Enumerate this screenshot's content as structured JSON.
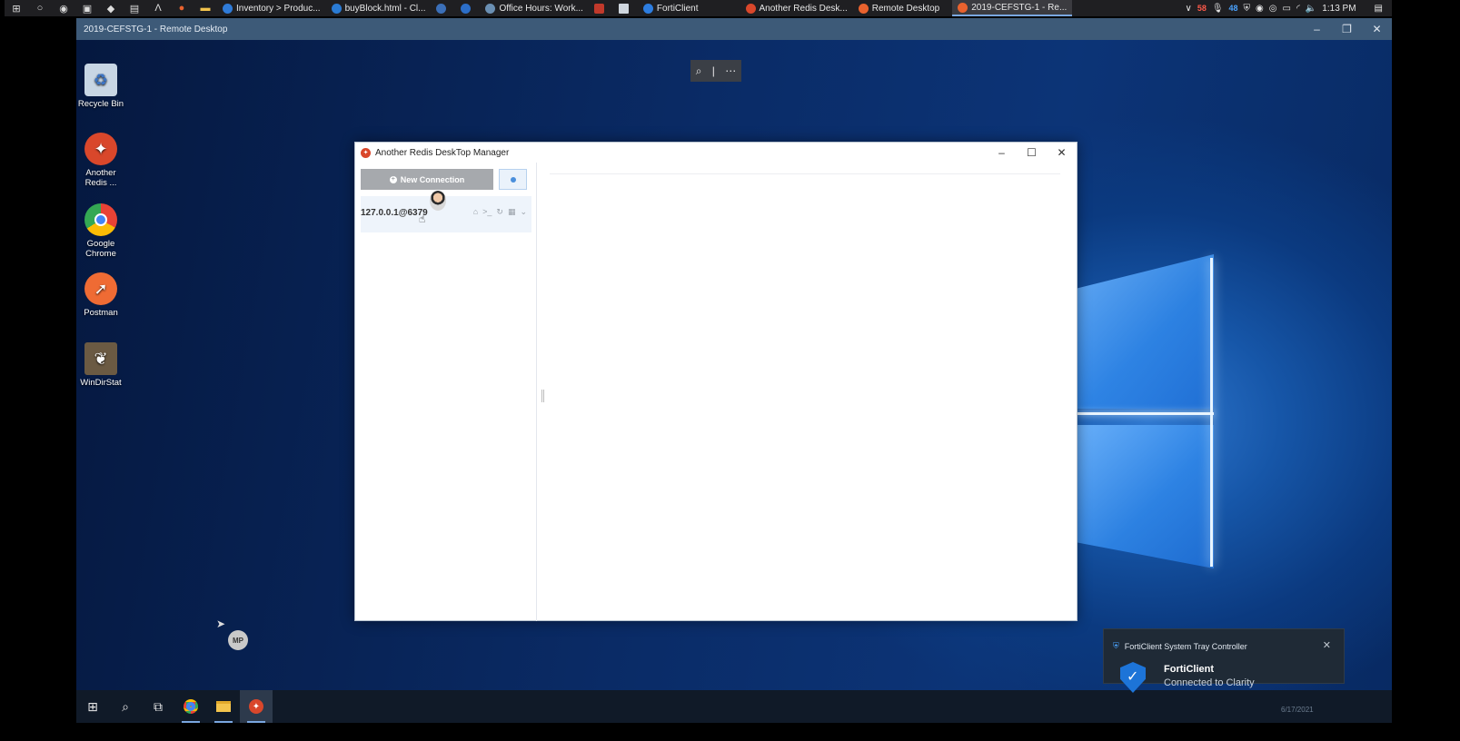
{
  "host_taskbar": {
    "tasks": [
      {
        "label": "Inventory > Produc...",
        "color": "#2f7bd8"
      },
      {
        "label": "buyBlock.html - Cl...",
        "color": "#2a7bd4"
      },
      {
        "label": "",
        "color": "#3b6fb8"
      },
      {
        "label": "",
        "color": "#2c6ec8"
      },
      {
        "label": "Office Hours: Work...",
        "color": "#6a8fb3"
      },
      {
        "label": "",
        "color": "#c0392b"
      },
      {
        "label": "",
        "color": "#cfd6de"
      },
      {
        "label": "FortiClient",
        "color": "#2d7de0"
      },
      {
        "label": "Another Redis Desk...",
        "color": "#d9472b"
      },
      {
        "label": "Remote Desktop",
        "color": "#e9622e"
      },
      {
        "label": "2019-CEFSTG-1 - Re...",
        "color": "#e9622e"
      }
    ],
    "tray": {
      "badge_red": "58",
      "badge_blue": "48",
      "clock": "1:13 PM"
    }
  },
  "rdp": {
    "title": "2019-CEFSTG-1 - Remote Desktop",
    "zoom_icon": "magnifier-icon",
    "more_icon": "ellipsis-icon"
  },
  "desktop_icons": [
    {
      "label": "Recycle Bin",
      "icon": "recycle-bin-icon",
      "color": "#5d7ea0"
    },
    {
      "label": "Another Redis ...",
      "icon": "redis-icon",
      "color": "#d9472b"
    },
    {
      "label": "Google Chrome",
      "icon": "chrome-icon",
      "color": "#4285f4"
    },
    {
      "label": "Postman",
      "icon": "postman-icon",
      "color": "#ef6b34"
    },
    {
      "label": "WinDirStat",
      "icon": "windirstat-icon",
      "color": "#6b5a43"
    }
  ],
  "ardm": {
    "title": "Another Redis DeskTop Manager",
    "new_connection": "New Connection",
    "connection_name": "127.0.0.1@6379"
  },
  "avatar_initials": "MP",
  "toast": {
    "header": "FortiClient System Tray Controller",
    "app": "FortiClient",
    "message": "Connected to Clarity",
    "date": "6/17/2021"
  },
  "colors": {
    "accent": "#4a8fdc",
    "redis": "#d9472b",
    "button_gray": "#a6a9ad"
  }
}
